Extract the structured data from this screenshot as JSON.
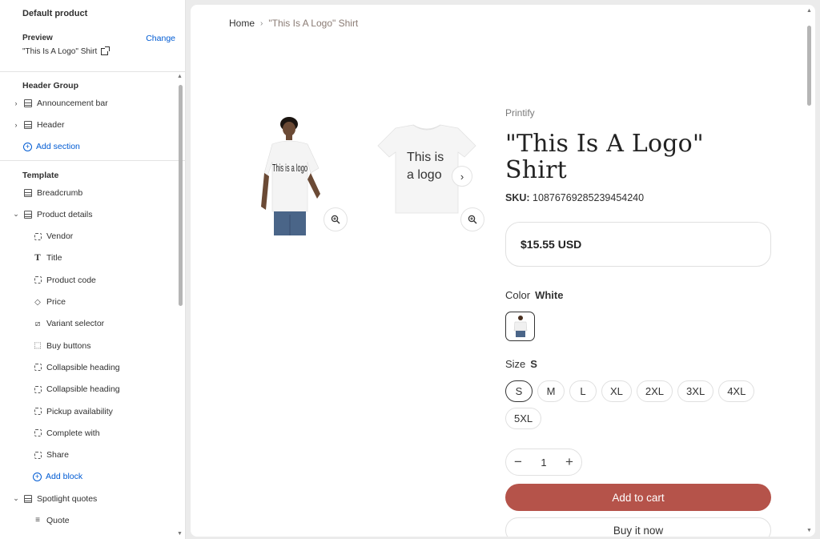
{
  "sidebar": {
    "title": "Default product",
    "preview_label": "Preview",
    "change_label": "Change",
    "preview_value": "\"This Is A Logo\" Shirt",
    "header_group": {
      "heading": "Header Group",
      "items": [
        {
          "label": "Announcement bar",
          "icon": "section-icon"
        },
        {
          "label": "Header",
          "icon": "section-icon"
        }
      ],
      "add_label": "Add section"
    },
    "template": {
      "heading": "Template",
      "breadcrumb_label": "Breadcrumb",
      "product_details_label": "Product details",
      "blocks": [
        {
          "label": "Vendor",
          "icon": "dashed-box-icon"
        },
        {
          "label": "Title",
          "icon": "title-icon"
        },
        {
          "label": "Product code",
          "icon": "dashed-box-icon"
        },
        {
          "label": "Price",
          "icon": "price-tag-icon"
        },
        {
          "label": "Variant selector",
          "icon": "variant-icon"
        },
        {
          "label": "Buy buttons",
          "icon": "cursor-icon"
        },
        {
          "label": "Collapsible heading",
          "icon": "dashed-box-icon"
        },
        {
          "label": "Collapsible heading",
          "icon": "dashed-box-icon"
        },
        {
          "label": "Pickup availability",
          "icon": "dashed-box-icon"
        },
        {
          "label": "Complete with",
          "icon": "dashed-box-icon"
        },
        {
          "label": "Share",
          "icon": "dashed-box-icon"
        }
      ],
      "add_block_label": "Add block",
      "spotlight_label": "Spotlight quotes",
      "quote_label": "Quote"
    }
  },
  "preview": {
    "breadcrumb": {
      "home": "Home",
      "separator": "›",
      "current": "\"This Is A Logo\" Shirt"
    },
    "image_text": {
      "model_shirt": "This is a logo",
      "flat_shirt_line1": "This is",
      "flat_shirt_line2": "a logo"
    },
    "vendor": "Printify",
    "title": "\"This Is A Logo\" Shirt",
    "sku_label": "SKU:",
    "sku_value": "10876769285239454240",
    "price": "$15.55 USD",
    "color_label": "Color",
    "color_value": "White",
    "size_label": "Size",
    "size_value": "S",
    "sizes": [
      "S",
      "M",
      "L",
      "XL",
      "2XL",
      "3XL",
      "4XL",
      "5XL"
    ],
    "selected_size": "S",
    "quantity": "1",
    "add_to_cart": "Add to cart",
    "buy_now": "Buy it now"
  },
  "colors": {
    "accent_link": "#005bd3",
    "add_to_cart_bg": "#b5534a"
  }
}
